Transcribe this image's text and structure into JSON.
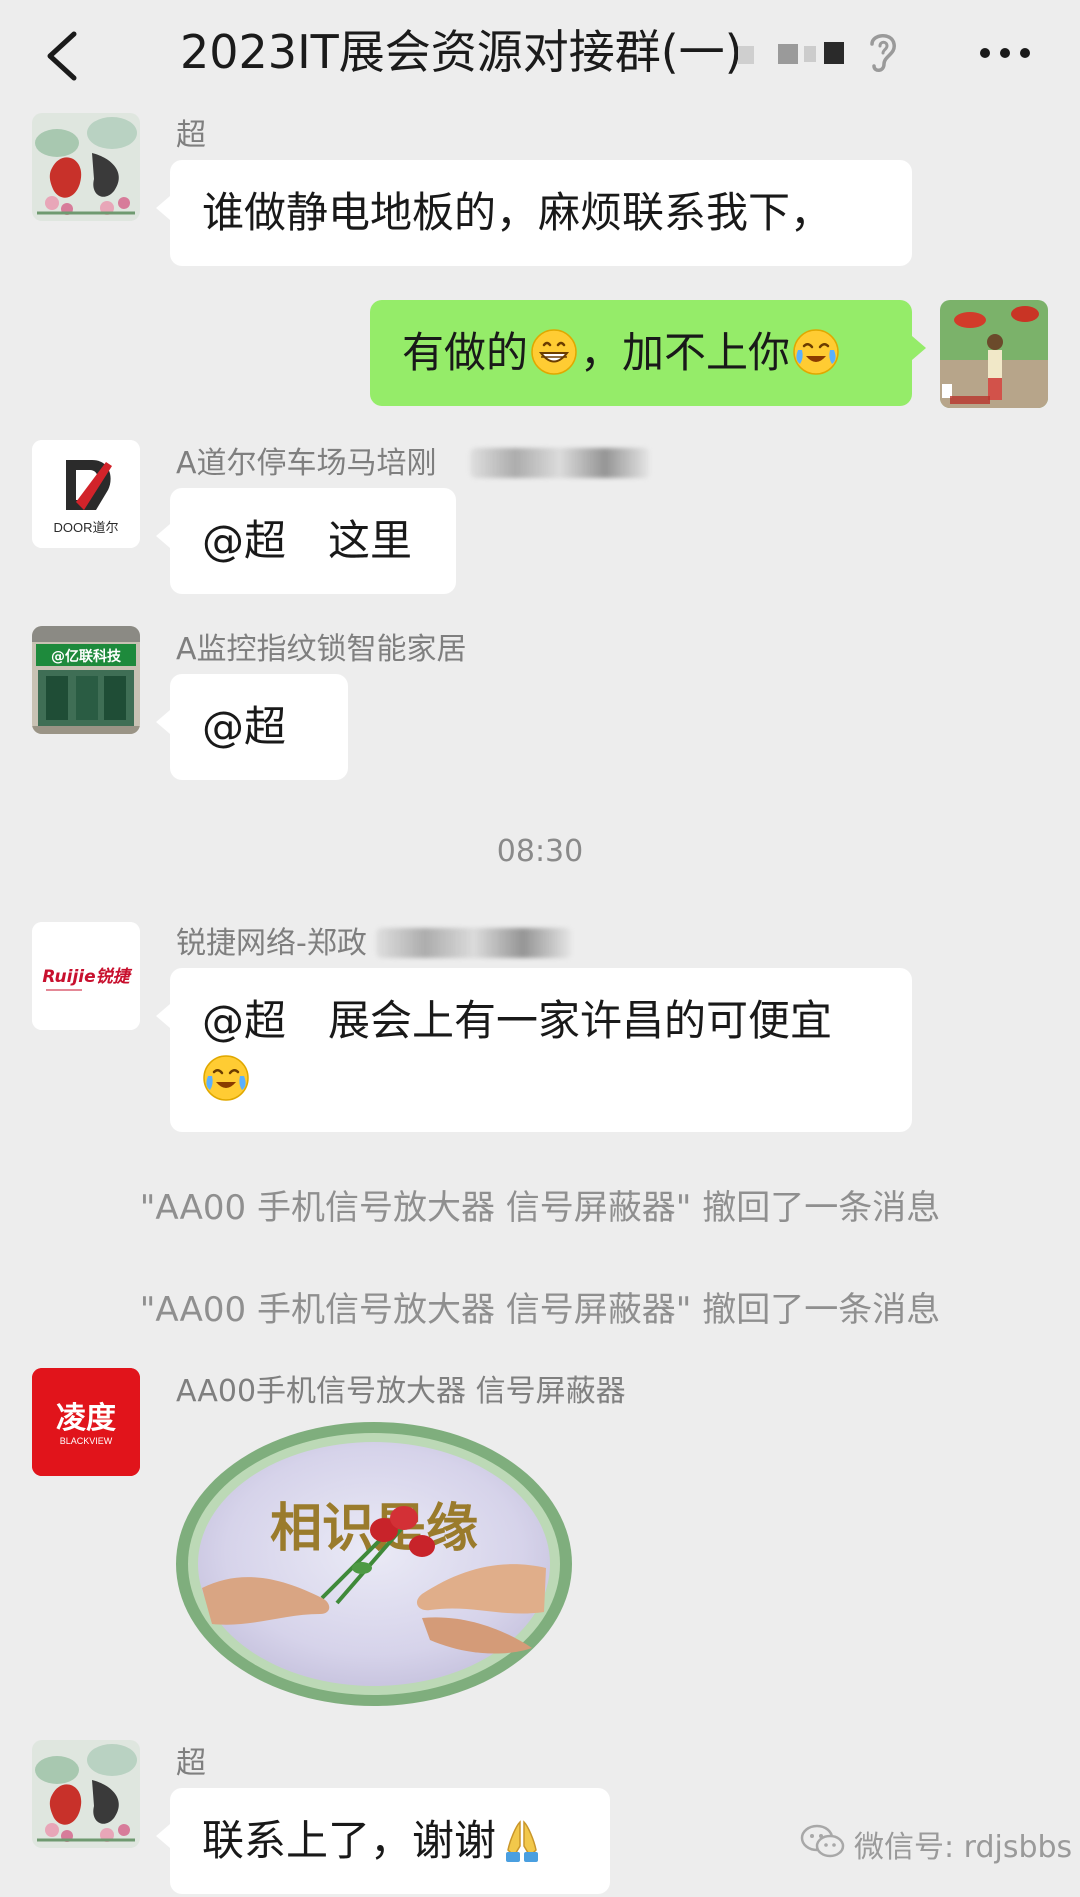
{
  "header": {
    "title": "2023IT展会资源对接群(一)",
    "back_icon": "chevron-left-icon",
    "mute_icon": "ear-icon",
    "more_icon": "more-dots-icon"
  },
  "messages": [
    {
      "sender": "超",
      "text": "谁做静电地板的，麻烦联系我下，"
    },
    {
      "mine": true,
      "text_before": "有做的",
      "text_middle": "，加不上你",
      "emoji_1": "grinning-emoji",
      "emoji_2": "crying-laughing-emoji"
    },
    {
      "sender": "A道尔停车场马培刚",
      "avatar_logo": "DOOR道尔",
      "text": "@超　这里"
    },
    {
      "sender": "A监控指纹锁智能家居",
      "avatar_sign": "@亿联科技",
      "text": "@超"
    },
    {
      "sender": "锐捷网络-郑政",
      "avatar_logo": "Ruijie锐捷",
      "text": "@超　展会上有一家许昌的可便宜",
      "emoji": "crying-laughing-emoji"
    },
    {
      "sender": "AA00手机信号放大器 信号屏蔽器",
      "avatar_logo_top": "凌度",
      "avatar_logo_bottom": "BLACKVIEW",
      "sticker_text": "相识是缘"
    },
    {
      "sender": "超",
      "text": "联系上了，谢谢",
      "emoji": "folded-hands-emoji"
    }
  ],
  "timestamp": "08:30",
  "system_messages": [
    "\"AA00 手机信号放大器 信号屏蔽器\" 撤回了一条消息",
    "\"AA00 手机信号放大器 信号屏蔽器\" 撤回了一条消息"
  ],
  "watermark": {
    "text": "微信号: rdjsbbs",
    "icon": "wechat-icon"
  },
  "colors": {
    "background": "#ededed",
    "bubble_mine": "#95ec69",
    "bubble_other": "#ffffff",
    "avatar_red": "#e1141b"
  }
}
